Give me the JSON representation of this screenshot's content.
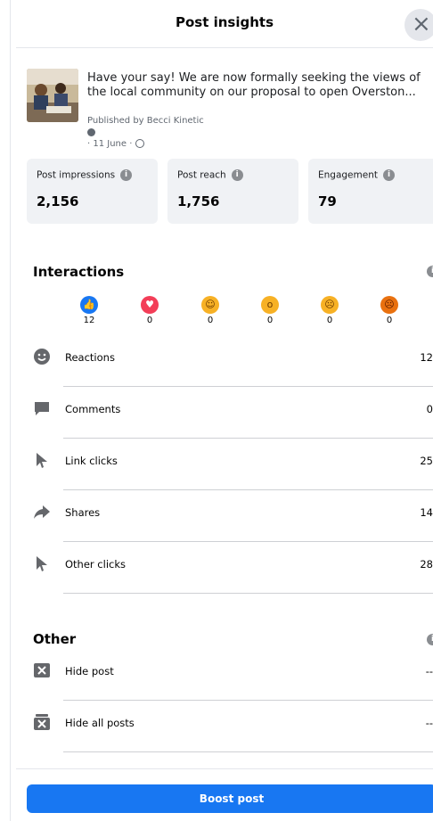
{
  "header": {
    "title": "Post insights",
    "close_glyph": "×"
  },
  "post": {
    "text_line1": "Have your say! We are now formally seeking the views of",
    "text_line2": "the local community on our proposal to open Overston...",
    "published_by": "Published by Becci Kinetic",
    "date": "· 11 June ·"
  },
  "stats": [
    {
      "label": "Post impressions",
      "value": "2,156"
    },
    {
      "label": "Post reach",
      "value": "1,756"
    },
    {
      "label": "Engagement",
      "value": "79"
    }
  ],
  "interactions": {
    "title": "Interactions",
    "reactions": [
      {
        "icon": "like-icon",
        "count": "12",
        "color": "#1877f2"
      },
      {
        "icon": "love-icon",
        "count": "0",
        "color": "#f33e58"
      },
      {
        "icon": "haha-icon",
        "count": "0",
        "color": "#f7b125"
      },
      {
        "icon": "wow-icon",
        "count": "0",
        "color": "#f7b125"
      },
      {
        "icon": "sad-icon",
        "count": "0",
        "color": "#f7b125"
      },
      {
        "icon": "angry-icon",
        "count": "0",
        "color": "#e9710f"
      }
    ],
    "rows": [
      {
        "icon": "smiley-icon",
        "label": "Reactions",
        "value": "12"
      },
      {
        "icon": "comment-icon",
        "label": "Comments",
        "value": "0"
      },
      {
        "icon": "cursor-icon",
        "label": "Link clicks",
        "value": "25"
      },
      {
        "icon": "share-icon",
        "label": "Shares",
        "value": "14"
      },
      {
        "icon": "cursor-icon",
        "label": "Other clicks",
        "value": "28"
      }
    ]
  },
  "other": {
    "title": "Other",
    "rows": [
      {
        "icon": "hide-icon",
        "label": "Hide post",
        "value": "--"
      },
      {
        "icon": "hide-all-icon",
        "label": "Hide all posts",
        "value": "--"
      }
    ]
  },
  "boost_label": "Boost post",
  "colors": {
    "accent": "#1877f2",
    "card_bg": "#f0f2f5",
    "icon_gray": "#65676b"
  }
}
